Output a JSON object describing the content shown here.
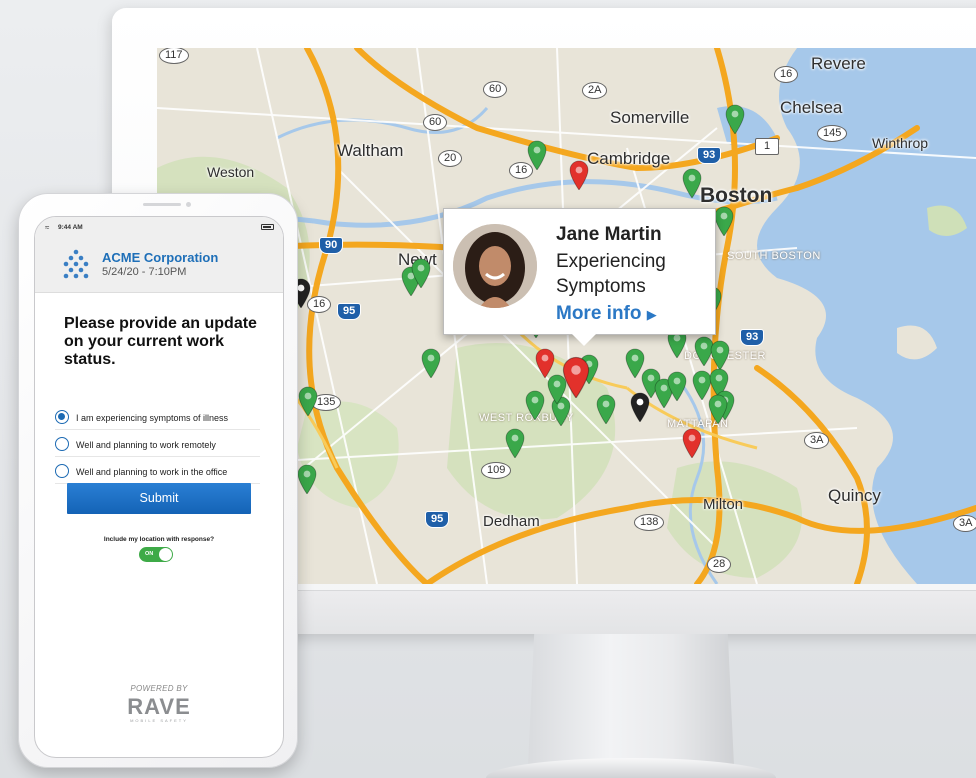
{
  "map": {
    "places": {
      "revere": "Revere",
      "chelsea": "Chelsea",
      "somerville": "Somerville",
      "waltham": "Waltham",
      "cambridge": "Cambridge",
      "winthrop": "Winthrop",
      "weston": "Weston",
      "boston": "Boston",
      "newton": "Newt",
      "south_boston": "SOUTH BOSTON",
      "dorchester": "DORCHESTER",
      "west_roxbury": "WEST ROXBURY",
      "mattapan": "MATTAPAN",
      "quincy": "Quincy",
      "milton": "Milton",
      "dedham": "Dedham"
    },
    "routes": {
      "r117": "117",
      "r60a": "60",
      "r2a": "2A",
      "r16a": "16",
      "r60b": "60",
      "r20": "20",
      "r16b": "16",
      "r145": "145",
      "i93a": "93",
      "r1": "1",
      "i90": "90",
      "r16c": "16",
      "i95a": "95",
      "i93b": "93",
      "r135": "135",
      "r3a": "3A",
      "r109": "109",
      "r138": "138",
      "i95b": "95",
      "r28": "28",
      "r3a2": "3A"
    }
  },
  "popup": {
    "name": "Jane Martin",
    "status": "Experiencing Symptoms",
    "more_info": "More info",
    "more_icon": "caret-right-icon"
  },
  "phone": {
    "time": "9:44 AM",
    "org_name": "ACME Corporation",
    "date": "5/24/20 - 7:10PM",
    "question": "Please provide an update on your current work status.",
    "options": [
      {
        "label": "I am experiencing symptoms of illness",
        "checked": true
      },
      {
        "label": "Well and planning to work remotely",
        "checked": false
      },
      {
        "label": "Well and planning to work in the office",
        "checked": false
      }
    ],
    "submit_label": "Submit",
    "location_label": "Include my location with response?",
    "toggle_label": "ON",
    "powered_by": "POWERED BY",
    "brand": "RAVE",
    "brand_sub": "MOBILE SAFETY"
  },
  "colors": {
    "accent": "#1c6ab3",
    "pin_green": "#3aa84a",
    "pin_red": "#e2312b",
    "pin_black": "#222222",
    "toggle_on": "#3eaa47"
  }
}
